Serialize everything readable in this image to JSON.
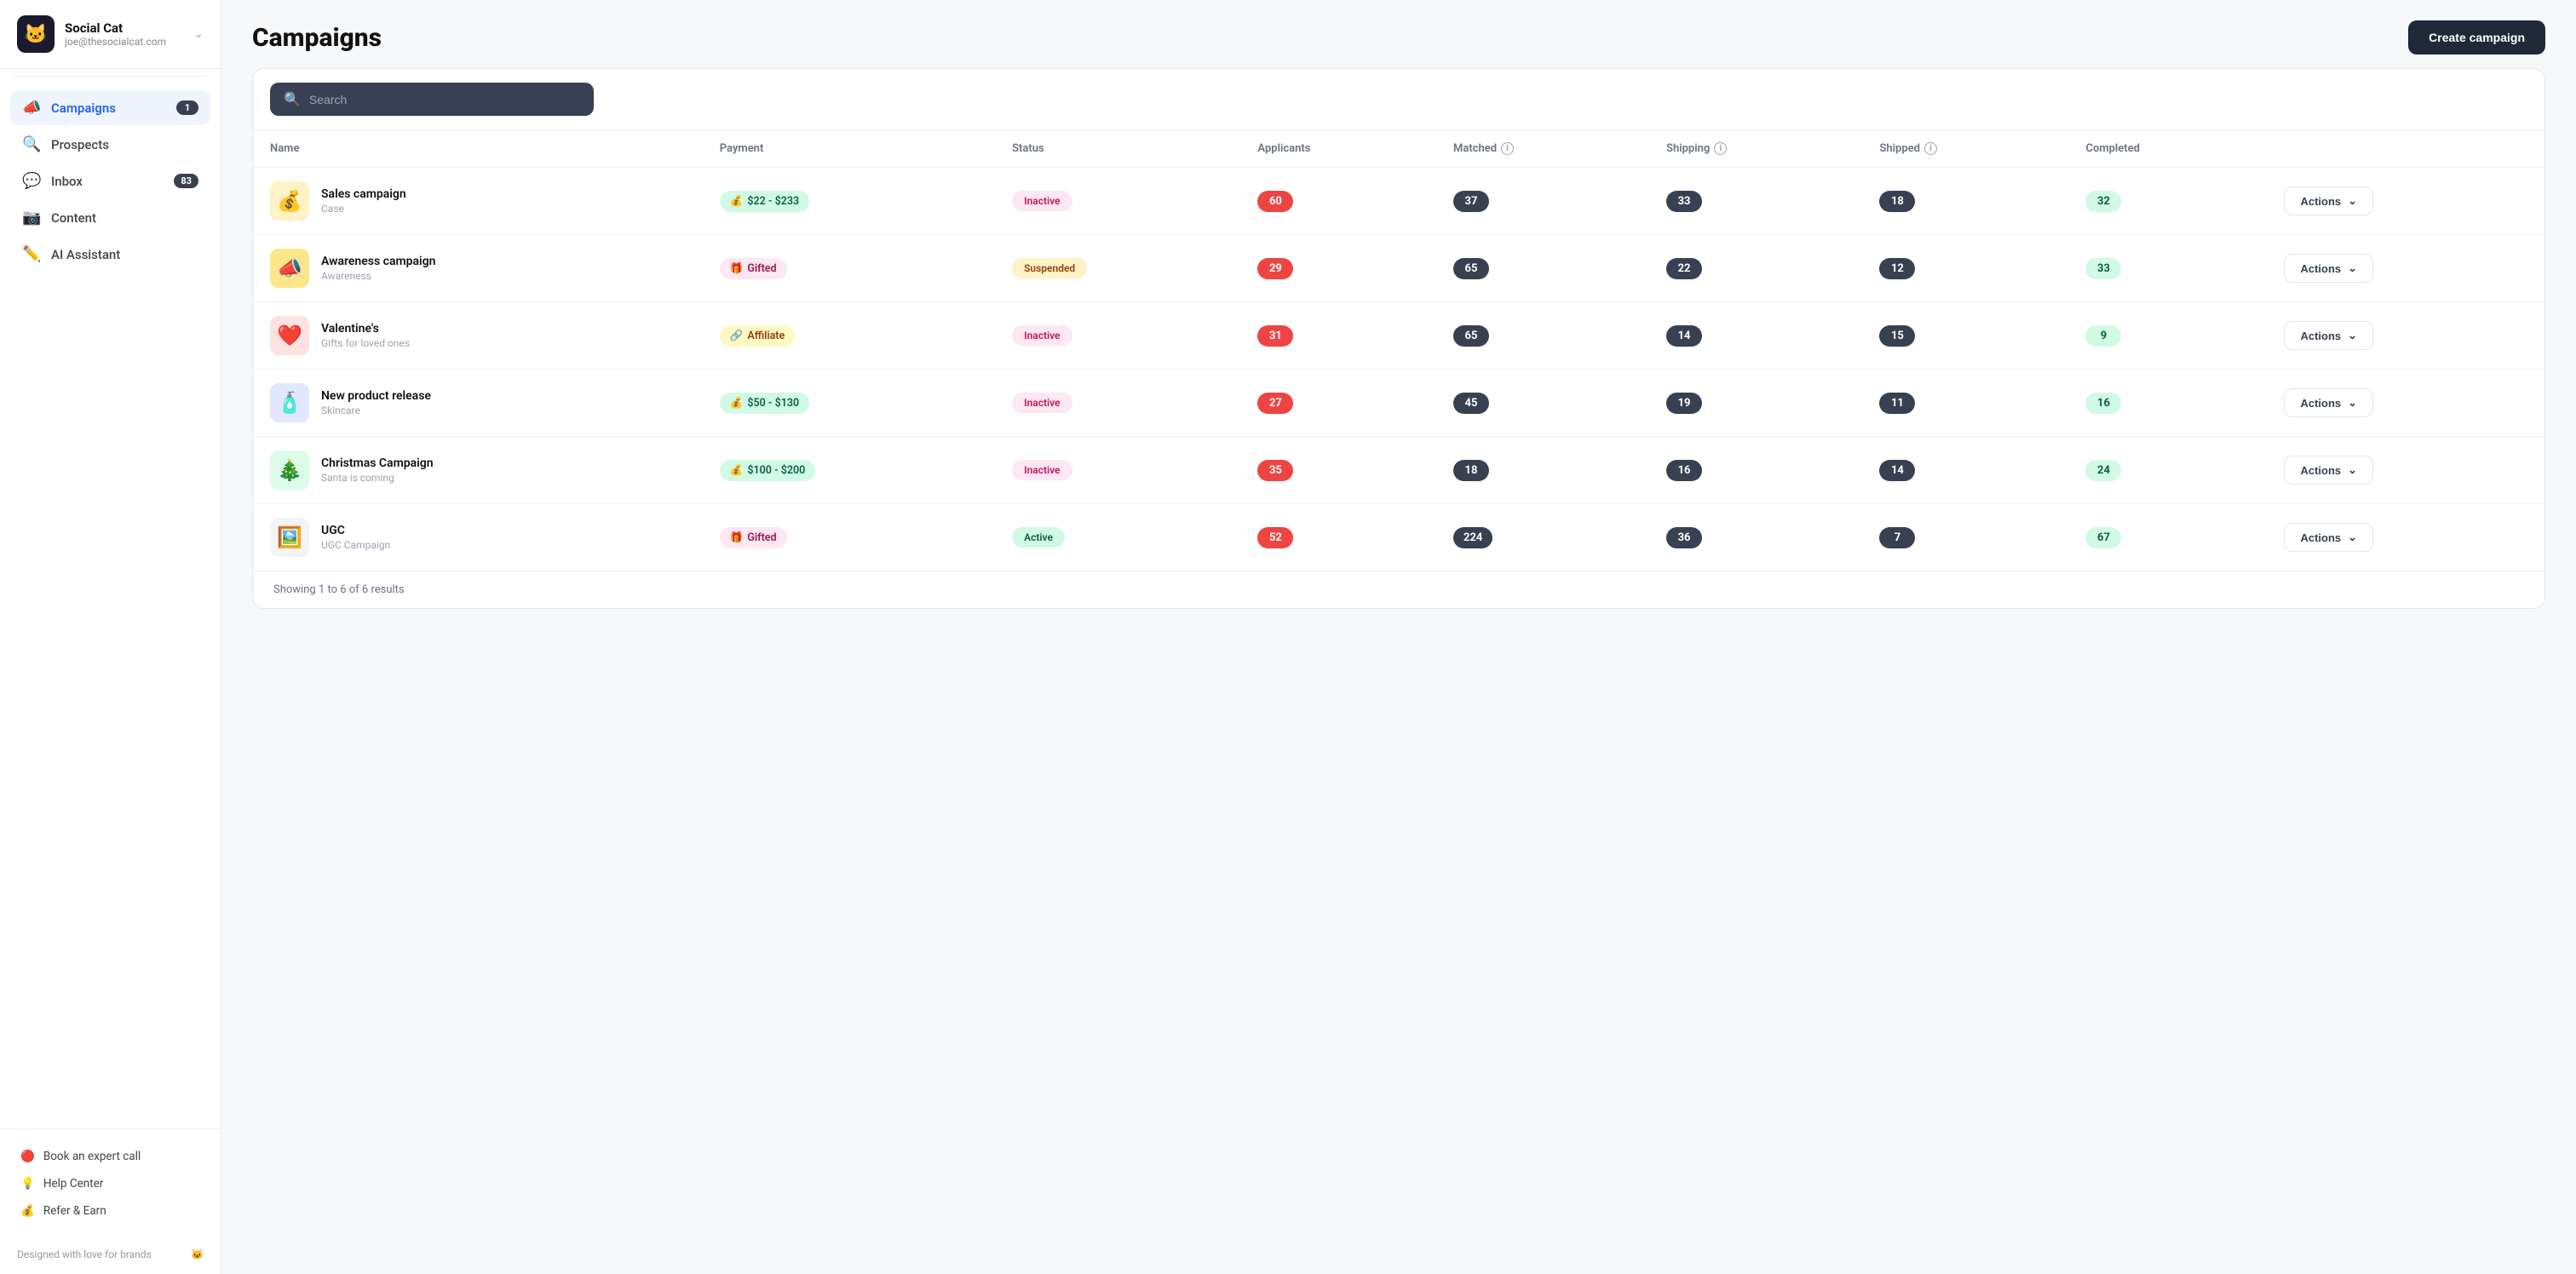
{
  "app": {
    "logo": "🐱",
    "brand_name": "Social Cat",
    "brand_email": "joe@thesocialcat.com"
  },
  "nav": {
    "items": [
      {
        "id": "campaigns",
        "label": "Campaigns",
        "icon": "📣",
        "badge": "1",
        "active": true
      },
      {
        "id": "prospects",
        "label": "Prospects",
        "icon": "🔍",
        "badge": null,
        "active": false
      },
      {
        "id": "inbox",
        "label": "Inbox",
        "icon": "💬",
        "badge": "83",
        "active": false
      },
      {
        "id": "content",
        "label": "Content",
        "icon": "📷",
        "badge": null,
        "active": false
      },
      {
        "id": "ai-assistant",
        "label": "AI Assistant",
        "icon": "✏️",
        "badge": null,
        "active": false
      }
    ]
  },
  "sidebar_bottom": [
    {
      "id": "book-expert",
      "label": "Book an expert call",
      "icon": "🔴"
    },
    {
      "id": "help-center",
      "label": "Help Center",
      "icon": "💡"
    },
    {
      "id": "refer-earn",
      "label": "Refer & Earn",
      "icon": "💰"
    }
  ],
  "footer_text": "Designed with love for brands",
  "page_title": "Campaigns",
  "create_button_label": "Create campaign",
  "search_placeholder": "Search",
  "table": {
    "columns": [
      {
        "key": "name",
        "label": "Name"
      },
      {
        "key": "payment",
        "label": "Payment"
      },
      {
        "key": "status",
        "label": "Status"
      },
      {
        "key": "applicants",
        "label": "Applicants"
      },
      {
        "key": "matched",
        "label": "Matched",
        "info": true
      },
      {
        "key": "shipping",
        "label": "Shipping",
        "info": true
      },
      {
        "key": "shipped",
        "label": "Shipped",
        "info": true
      },
      {
        "key": "completed",
        "label": "Completed"
      }
    ],
    "rows": [
      {
        "id": "sales-campaign",
        "emoji": "💰",
        "emoji_bg": "#fef3c7",
        "name": "Sales campaign",
        "sub": "Case",
        "payment": "$22 - $233",
        "payment_type": "paid",
        "status": "Inactive",
        "status_type": "inactive",
        "applicants": 60,
        "matched": 37,
        "shipping": 33,
        "shipped": 18,
        "completed": 32
      },
      {
        "id": "awareness-campaign",
        "emoji": "📣",
        "emoji_bg": "#fde68a",
        "name": "Awareness campaign",
        "sub": "Awareness",
        "payment": "Gifted",
        "payment_type": "gifted",
        "status": "Suspended",
        "status_type": "suspended",
        "applicants": 29,
        "matched": 65,
        "shipping": 22,
        "shipped": 12,
        "completed": 33
      },
      {
        "id": "valentines",
        "emoji": "❤️",
        "emoji_bg": "#fee2e2",
        "name": "Valentine's",
        "sub": "Gifts for loved ones",
        "payment": "Affiliate",
        "payment_type": "affiliate",
        "status": "Inactive",
        "status_type": "inactive",
        "applicants": 31,
        "matched": 65,
        "shipping": 14,
        "shipped": 15,
        "completed": 9
      },
      {
        "id": "new-product-release",
        "emoji": "🧴",
        "emoji_bg": "#e0e7ff",
        "name": "New product release",
        "sub": "Skincare",
        "payment": "$50 - $130",
        "payment_type": "paid",
        "status": "Inactive",
        "status_type": "inactive",
        "applicants": 27,
        "matched": 45,
        "shipping": 19,
        "shipped": 11,
        "completed": 16
      },
      {
        "id": "christmas-campaign",
        "emoji": "🎄",
        "emoji_bg": "#dcfce7",
        "name": "Christmas Campaign",
        "sub": "Santa is coming",
        "payment": "$100 - $200",
        "payment_type": "paid",
        "status": "Inactive",
        "status_type": "inactive",
        "applicants": 35,
        "matched": 18,
        "shipping": 16,
        "shipped": 14,
        "completed": 24
      },
      {
        "id": "ugc",
        "emoji": "🖼️",
        "emoji_bg": "#f3f4f6",
        "name": "UGC",
        "sub": "UGC Campaign",
        "payment": "Gifted",
        "payment_type": "gifted",
        "status": "Active",
        "status_type": "active",
        "applicants": 52,
        "matched": 224,
        "shipping": 36,
        "shipped": 7,
        "completed": 67
      }
    ],
    "footer": "Showing 1 to 6 of 6 results"
  },
  "actions_label": "Actions"
}
